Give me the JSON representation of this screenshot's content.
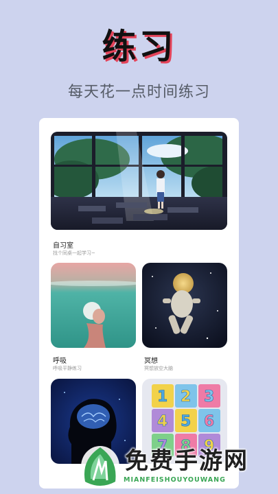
{
  "header": {
    "title": "练习",
    "subtitle": "每天花一点时间练习"
  },
  "cards": {
    "hero": {
      "title": "自习室",
      "desc": "找个同桌一起学习~"
    },
    "breathe": {
      "title": "呼吸",
      "desc": "呼吸平静练习"
    },
    "meditate": {
      "title": "冥想",
      "desc": "冥想放空大脑"
    }
  },
  "watermark": {
    "text": "免费手游网",
    "url": "MIANFEISHOUYOUWANG"
  },
  "colors": {
    "background": "#cdd3ee",
    "title_shadow": "#e4445a",
    "watermark_green": "#3aa655"
  }
}
